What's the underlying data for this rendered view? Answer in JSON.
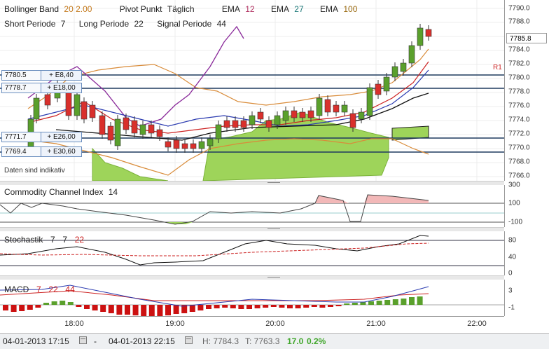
{
  "main": {
    "legend1": [
      {
        "name": "Bollinger Band",
        "params": "20  2.00",
        "color": "#c47a1e"
      },
      {
        "name": "Pivot Punkt",
        "params": "Täglich",
        "color": "#222222"
      },
      {
        "name": "EMA",
        "params": "12",
        "color": "#b03060"
      },
      {
        "name": "EMA",
        "params": "27",
        "color": "#1f7a7a"
      },
      {
        "name": "EMA",
        "params": "100",
        "color": "#9a6a10"
      }
    ],
    "legend2": [
      {
        "name": "Short Periode",
        "params": "7"
      },
      {
        "name": "Long Periode",
        "params": "22"
      },
      {
        "name": "Signal Periode",
        "params": "44"
      }
    ],
    "ticks": [
      "7790.0",
      "7788.0",
      "7784.0",
      "7782.0",
      "7780.0",
      "7778.0",
      "7776.0",
      "7774.0",
      "7772.0",
      "7770.0",
      "7768.0",
      "7766.0"
    ],
    "current_price": "7785.8",
    "r1_label": "R1",
    "disclaimer": "Daten sind indikativ",
    "price_tags": [
      {
        "price": "7780.5",
        "amount": "+ E8,40"
      },
      {
        "price": "7778.7",
        "amount": "+ E18,00"
      },
      {
        "price": "7771.7",
        "amount": "+ E26,00"
      },
      {
        "price": "7769.4",
        "amount": "+ E30,60"
      }
    ]
  },
  "cci": {
    "name": "Commodity Channel Index",
    "param": "14",
    "ticks": [
      "300",
      "100",
      "-100"
    ]
  },
  "stoch": {
    "name": "Stochastik",
    "params": [
      "7",
      "7",
      "22"
    ],
    "param_colors": [
      "#222222",
      "#222222",
      "#cc2222"
    ],
    "ticks": [
      "80",
      "40",
      "0"
    ]
  },
  "macd": {
    "name": "MACD",
    "params": [
      "7",
      "22",
      "44"
    ],
    "ticks": [
      "3",
      "-1"
    ]
  },
  "time_axis": [
    "18:00",
    "19:00",
    "20:00",
    "21:00",
    "22:00"
  ],
  "footer": {
    "from": "04-01-2013 17:15",
    "to": "04-01-2013 22:15",
    "high": "H: 7784.3",
    "low": "T: 7763.3",
    "change": "17.0",
    "change_pct": "0.2%"
  },
  "colors": {
    "up": "#5aa02c",
    "down": "#d9302c",
    "band": "#d98c3a",
    "cloud": "#9ed45a",
    "pivot": "#1f3a5f"
  }
}
